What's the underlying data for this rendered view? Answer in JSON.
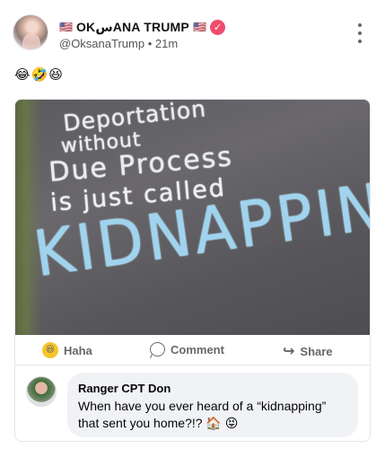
{
  "post": {
    "flag_left": "🇺🇸",
    "display_name": "OKسANA TRUMP",
    "flag_right": "🇺🇸",
    "verified_mark": "✓",
    "handle": "@OksanaTrump",
    "time": "21m",
    "emojis": "😂🤣😆"
  },
  "image": {
    "line1": "Deportation",
    "line2": "without",
    "line3": "Due Process",
    "line4": "is just called",
    "line5": "KIDNAPPIN"
  },
  "actions": {
    "haha": "Haha",
    "comment": "Comment",
    "share": "Share"
  },
  "comment": {
    "author": "Ranger CPT Don",
    "text": "When have you ever heard of a “kidnapping” that sent you home?!? 🏠 😝"
  },
  "colors": {
    "verified": "#ef4d6d",
    "chalk_blue": "#9fd3ee",
    "action_gray": "#65676b"
  }
}
